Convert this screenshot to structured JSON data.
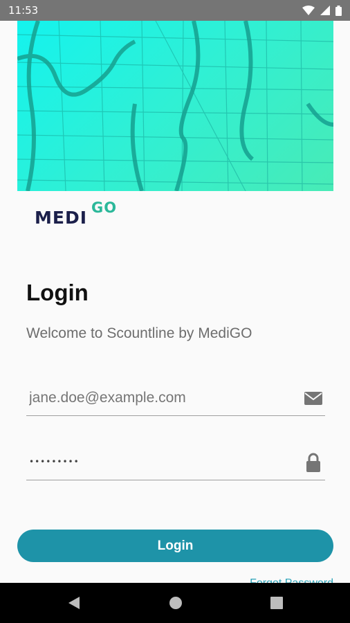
{
  "status_bar": {
    "time": "11:53",
    "icons": [
      "wifi-icon",
      "signal-icon",
      "battery-icon"
    ]
  },
  "brand": {
    "logo_part1": "MEDI",
    "logo_part2": "GO",
    "colors": {
      "navy": "#1b1f4a",
      "green": "#2bb89a"
    }
  },
  "login": {
    "title": "Login",
    "subtitle": "Welcome to Scountline by MediGO",
    "email": {
      "placeholder": "jane.doe@example.com",
      "icon": "mail-icon"
    },
    "password": {
      "value": "•••••••••",
      "icon": "lock-icon"
    },
    "button_label": "Login",
    "forgot_label": "Forgot Password"
  },
  "theme": {
    "accent": "#1e93a8",
    "link": "#2aa3b8"
  },
  "nav": {
    "icons": [
      "back-icon",
      "home-icon",
      "recents-icon"
    ]
  }
}
